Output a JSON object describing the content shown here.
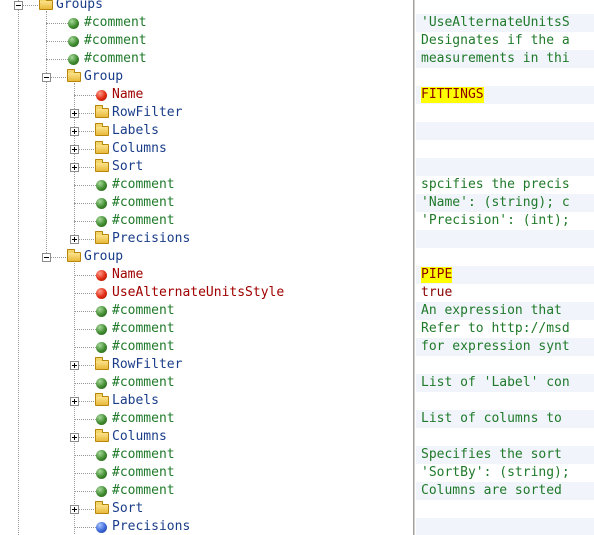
{
  "tree": {
    "rows": [
      {
        "depth": 1,
        "kind": "folder",
        "expander": "minus",
        "label": "Groups"
      },
      {
        "depth": 2,
        "kind": "comment",
        "expander": "none",
        "label": "#comment"
      },
      {
        "depth": 2,
        "kind": "comment",
        "expander": "none",
        "label": "#comment"
      },
      {
        "depth": 2,
        "kind": "comment",
        "expander": "none",
        "label": "#comment"
      },
      {
        "depth": 2,
        "kind": "folder",
        "expander": "minus",
        "label": "Group"
      },
      {
        "depth": 3,
        "kind": "attr",
        "expander": "none",
        "label": "Name"
      },
      {
        "depth": 3,
        "kind": "folder",
        "expander": "plus",
        "label": "RowFilter"
      },
      {
        "depth": 3,
        "kind": "folder",
        "expander": "plus",
        "label": "Labels"
      },
      {
        "depth": 3,
        "kind": "folder",
        "expander": "plus",
        "label": "Columns"
      },
      {
        "depth": 3,
        "kind": "folder",
        "expander": "plus",
        "label": "Sort"
      },
      {
        "depth": 3,
        "kind": "comment",
        "expander": "none",
        "label": "#comment"
      },
      {
        "depth": 3,
        "kind": "comment",
        "expander": "none",
        "label": "#comment"
      },
      {
        "depth": 3,
        "kind": "comment",
        "expander": "none",
        "label": "#comment"
      },
      {
        "depth": 3,
        "kind": "folder",
        "expander": "plus",
        "label": "Precisions"
      },
      {
        "depth": 2,
        "kind": "folder",
        "expander": "minus",
        "label": "Group"
      },
      {
        "depth": 3,
        "kind": "attr",
        "expander": "none",
        "label": "Name"
      },
      {
        "depth": 3,
        "kind": "attr",
        "expander": "none",
        "label": "UseAlternateUnitsStyle"
      },
      {
        "depth": 3,
        "kind": "comment",
        "expander": "none",
        "label": "#comment"
      },
      {
        "depth": 3,
        "kind": "comment",
        "expander": "none",
        "label": "#comment"
      },
      {
        "depth": 3,
        "kind": "comment",
        "expander": "none",
        "label": "#comment"
      },
      {
        "depth": 3,
        "kind": "folder",
        "expander": "plus",
        "label": "RowFilter"
      },
      {
        "depth": 3,
        "kind": "comment",
        "expander": "none",
        "label": "#comment"
      },
      {
        "depth": 3,
        "kind": "folder",
        "expander": "plus",
        "label": "Labels"
      },
      {
        "depth": 3,
        "kind": "comment",
        "expander": "none",
        "label": "#comment"
      },
      {
        "depth": 3,
        "kind": "folder",
        "expander": "plus",
        "label": "Columns"
      },
      {
        "depth": 3,
        "kind": "comment",
        "expander": "none",
        "label": "#comment"
      },
      {
        "depth": 3,
        "kind": "comment",
        "expander": "none",
        "label": "#comment"
      },
      {
        "depth": 3,
        "kind": "comment",
        "expander": "none",
        "label": "#comment"
      },
      {
        "depth": 3,
        "kind": "folder",
        "expander": "plus",
        "label": "Sort"
      },
      {
        "depth": 3,
        "kind": "blue",
        "expander": "none",
        "label": "Precisions"
      }
    ]
  },
  "values": {
    "rows": [
      {
        "text": "",
        "kind": "comment",
        "highlight": false
      },
      {
        "text": "'UseAlternateUnitsS",
        "kind": "comment",
        "highlight": false
      },
      {
        "text": "Designates if the a",
        "kind": "comment",
        "highlight": false
      },
      {
        "text": "measurements in thi",
        "kind": "comment",
        "highlight": false
      },
      {
        "text": "",
        "kind": "comment",
        "highlight": false
      },
      {
        "text": "FITTINGS",
        "kind": "value",
        "highlight": true
      },
      {
        "text": "",
        "kind": "comment",
        "highlight": false
      },
      {
        "text": "",
        "kind": "comment",
        "highlight": false
      },
      {
        "text": "",
        "kind": "comment",
        "highlight": false
      },
      {
        "text": "",
        "kind": "comment",
        "highlight": false
      },
      {
        "text": "spcifies the precis",
        "kind": "comment",
        "highlight": false
      },
      {
        "text": "'Name': (string); c",
        "kind": "comment",
        "highlight": false
      },
      {
        "text": "'Precision': (int);",
        "kind": "comment",
        "highlight": false
      },
      {
        "text": "",
        "kind": "comment",
        "highlight": false
      },
      {
        "text": "",
        "kind": "comment",
        "highlight": false
      },
      {
        "text": "PIPE",
        "kind": "value",
        "highlight": true
      },
      {
        "text": "true",
        "kind": "value",
        "highlight": false
      },
      {
        "text": "An expression that ",
        "kind": "comment",
        "highlight": false
      },
      {
        "text": "Refer to http://msd",
        "kind": "comment",
        "highlight": false
      },
      {
        "text": "for expression synt",
        "kind": "comment",
        "highlight": false
      },
      {
        "text": "",
        "kind": "comment",
        "highlight": false
      },
      {
        "text": "List of 'Label' con",
        "kind": "comment",
        "highlight": false
      },
      {
        "text": "",
        "kind": "comment",
        "highlight": false
      },
      {
        "text": "List of columns to ",
        "kind": "comment",
        "highlight": false
      },
      {
        "text": "",
        "kind": "comment",
        "highlight": false
      },
      {
        "text": "Specifies the sort ",
        "kind": "comment",
        "highlight": false
      },
      {
        "text": "'SortBy': (string);",
        "kind": "comment",
        "highlight": false
      },
      {
        "text": "Columns are sorted ",
        "kind": "comment",
        "highlight": false
      },
      {
        "text": "",
        "kind": "comment",
        "highlight": false
      },
      {
        "text": "",
        "kind": "comment",
        "highlight": false
      }
    ]
  },
  "colors": {
    "folder_label": "#1a3d8a",
    "comment_label": "#1f7a2a",
    "attribute_label": "#a00000",
    "highlight": "#ffff00",
    "band": "#f1f4fb"
  }
}
